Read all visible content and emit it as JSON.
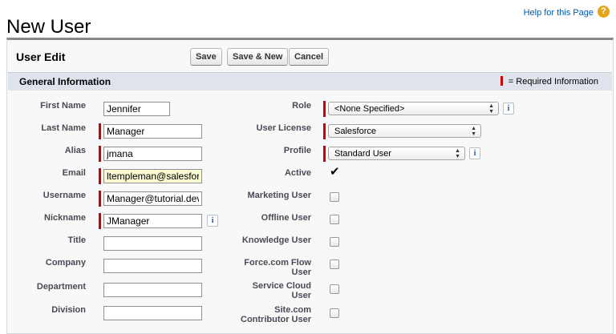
{
  "page": {
    "title": "New User",
    "help_link": "Help for this Page",
    "help_icon": "?"
  },
  "panel": {
    "title": "User Edit",
    "buttons": {
      "save": "Save",
      "save_new": "Save & New",
      "cancel": "Cancel"
    }
  },
  "section": {
    "title": "General Information",
    "required_legend": "= Required Information"
  },
  "left_fields": [
    {
      "label": "First Name",
      "value": "Jennifer",
      "required": false
    },
    {
      "label": "Last Name",
      "value": "Manager",
      "required": true
    },
    {
      "label": "Alias",
      "value": "jmana",
      "required": true
    },
    {
      "label": "Email",
      "value": "ltempleman@salesforce",
      "required": true
    },
    {
      "label": "Username",
      "value": "Manager@tutorial.dev",
      "required": true
    },
    {
      "label": "Nickname",
      "value": "JManager",
      "required": true
    },
    {
      "label": "Title",
      "value": "",
      "required": false
    },
    {
      "label": "Company",
      "value": "",
      "required": false
    },
    {
      "label": "Department",
      "value": "",
      "required": false
    },
    {
      "label": "Division",
      "value": "",
      "required": false
    }
  ],
  "right_fields": {
    "role": {
      "label": "Role",
      "value": "<None Specified>"
    },
    "user_license": {
      "label": "User License",
      "value": "Salesforce"
    },
    "profile": {
      "label": "Profile",
      "value": "Standard User"
    },
    "active": {
      "label": "Active",
      "checked": true,
      "mark": "✔"
    },
    "checkboxes": [
      {
        "label_lines": [
          "Marketing User"
        ],
        "checked": false
      },
      {
        "label_lines": [
          "Offline User"
        ],
        "checked": false
      },
      {
        "label_lines": [
          "Knowledge User"
        ],
        "checked": false
      },
      {
        "label_lines": [
          "Force.com Flow",
          "User"
        ],
        "checked": false
      },
      {
        "label_lines": [
          "Service Cloud",
          "User"
        ],
        "checked": false
      },
      {
        "label_lines": [
          "Site.com",
          "Contributor User"
        ],
        "checked": false
      }
    ]
  },
  "info_icon_glyph": "i",
  "colors": {
    "required": "#cc0000",
    "link": "#015ba7",
    "section_bg": "#dfe4ec"
  }
}
